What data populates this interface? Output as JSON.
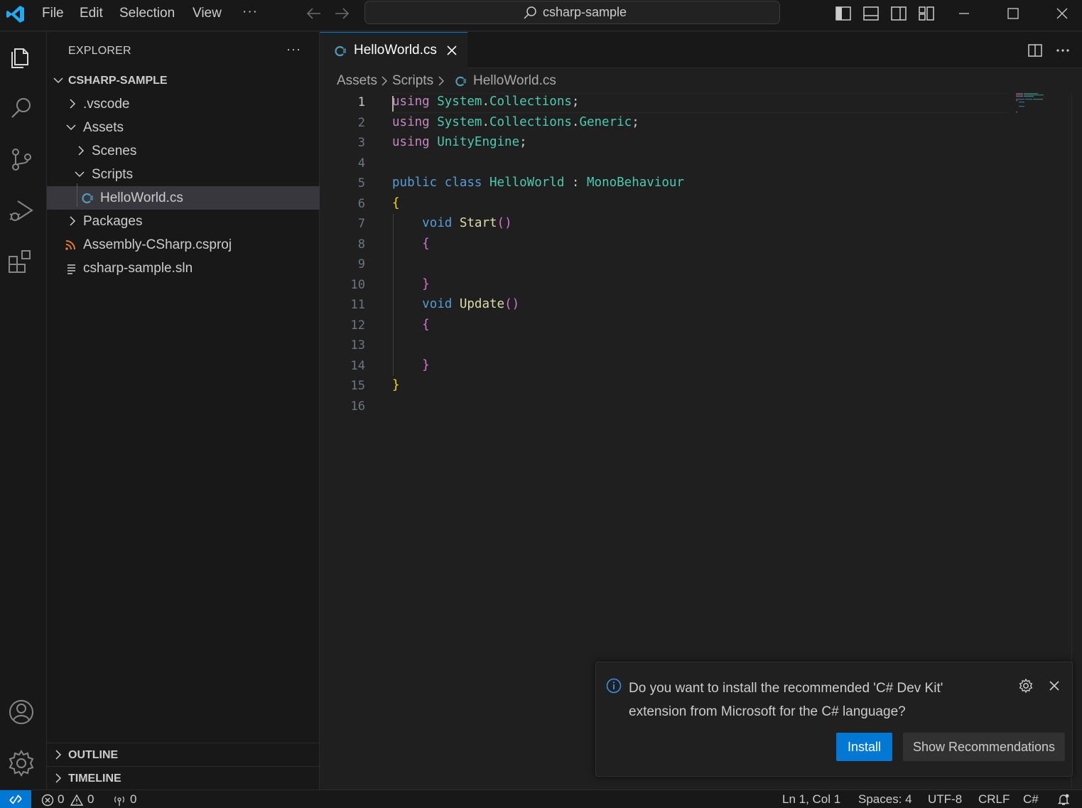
{
  "titlebar": {
    "menu": [
      "File",
      "Edit",
      "Selection",
      "View"
    ],
    "more": "···",
    "search_text": "csharp-sample"
  },
  "sidebar": {
    "title": "EXPLORER",
    "more": "···",
    "root": "CSHARP-SAMPLE",
    "items": [
      {
        "label": ".vscode"
      },
      {
        "label": "Assets"
      },
      {
        "label": "Scenes"
      },
      {
        "label": "Scripts"
      },
      {
        "label": "HelloWorld.cs"
      },
      {
        "label": "Packages"
      },
      {
        "label": "Assembly-CSharp.csproj"
      },
      {
        "label": "csharp-sample.sln"
      }
    ],
    "outline": "OUTLINE",
    "timeline": "TIMELINE"
  },
  "editor": {
    "tab_label": "HelloWorld.cs",
    "breadcrumb": [
      "Assets",
      "Scripts",
      "HelloWorld.cs"
    ],
    "line_numbers": [
      "1",
      "2",
      "3",
      "4",
      "5",
      "6",
      "7",
      "8",
      "9",
      "10",
      "11",
      "12",
      "13",
      "14",
      "15",
      "16"
    ]
  },
  "notification": {
    "message": "Do you want to install the recommended 'C# Dev Kit' extension from Microsoft for the C# language?",
    "install": "Install",
    "show_recommendations": "Show Recommendations"
  },
  "statusbar": {
    "errors": "0",
    "warnings": "0",
    "ports": "0",
    "position": "Ln 1, Col 1",
    "spaces": "Spaces: 4",
    "encoding": "UTF-8",
    "eol": "CRLF",
    "language": "C#"
  },
  "colors": {
    "accent": "#0078d4",
    "keyword": "#569cd6",
    "control_keyword": "#c586c0",
    "type": "#4ec9b0",
    "function": "#dcdcaa",
    "bracket_level1": "#ffd700",
    "bracket_level2": "#da70d6"
  }
}
